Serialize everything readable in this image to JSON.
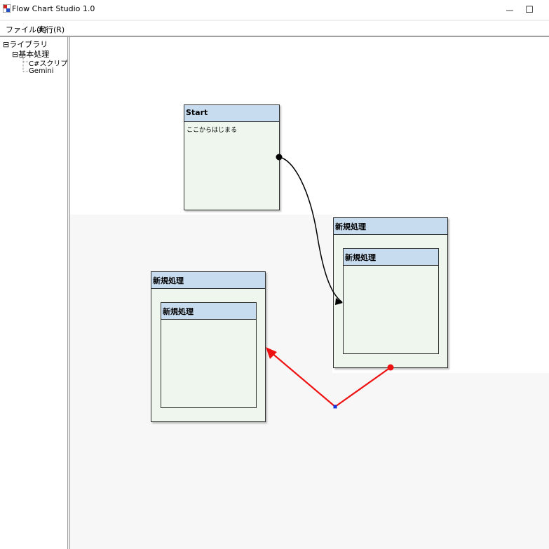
{
  "window": {
    "title": "Flow Chart Studio 1.0",
    "minimize_glyph": "—",
    "maximize_glyph": "☐"
  },
  "menu": {
    "items": [
      {
        "label": "ファイル(F)"
      },
      {
        "label": "実行(R)"
      }
    ]
  },
  "tree": {
    "root": {
      "expander": "⊟",
      "label": "ライブラリ"
    },
    "group": {
      "expander": "⊟",
      "label": "基本処理"
    },
    "leaves": [
      {
        "label": "C#スクリプト"
      },
      {
        "label": "Gemini"
      }
    ]
  },
  "nodes": {
    "start": {
      "title": "Start",
      "body": "ここからはじまる"
    },
    "right_outer": {
      "title": "新規処理"
    },
    "right_inner": {
      "title": "新規処理"
    },
    "left_outer": {
      "title": "新規処理"
    },
    "left_inner": {
      "title": "新規処理"
    }
  },
  "colors": {
    "node_header": "#c8dcf0",
    "node_body": "#eef6ee",
    "connector_selected": "#ee1111",
    "connector_normal": "#000000",
    "bend_handle": "#1133dd"
  }
}
